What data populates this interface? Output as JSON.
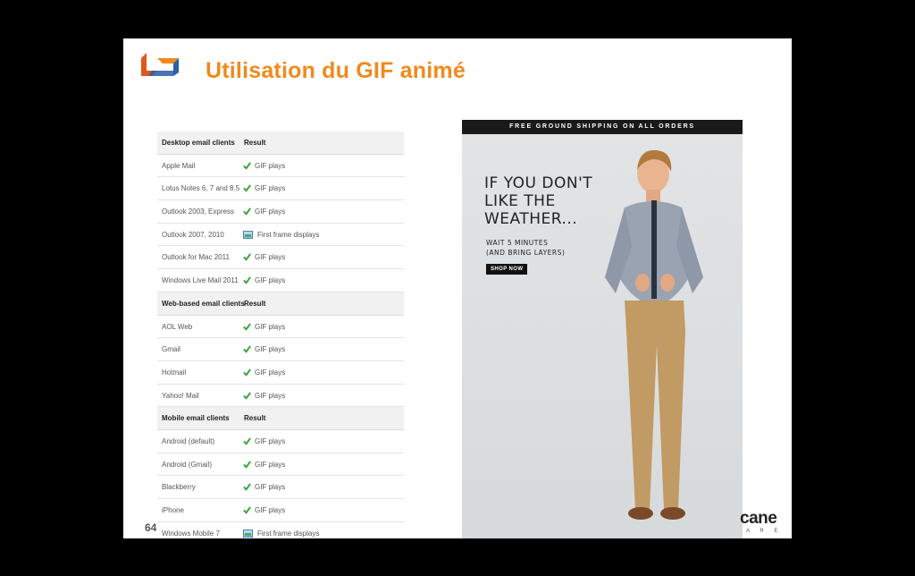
{
  "slide": {
    "title": "Utilisation du GIF animé",
    "page_number": "64",
    "colors": {
      "title": "#f08a1c",
      "check": "#3aa63a"
    }
  },
  "table": {
    "rows": [
      {
        "type": "header",
        "client": "Desktop email clients",
        "result": "Result"
      },
      {
        "client": "Apple Mail",
        "result": "GIF plays",
        "icon": "check-icon"
      },
      {
        "client": "Lotus Notes 6, 7 and 8.5",
        "result": "GIF plays",
        "icon": "check-icon"
      },
      {
        "client": "Outlook 2003, Express",
        "result": "GIF plays",
        "icon": "check-icon"
      },
      {
        "client": "Outlook 2007, 2010",
        "result": "First frame displays",
        "icon": "image-frame-icon"
      },
      {
        "client": "Outlook for Mac 2011",
        "result": "GIF plays",
        "icon": "check-icon"
      },
      {
        "client": "Windows Live Mail 2011",
        "result": "GIF plays",
        "icon": "check-icon"
      },
      {
        "type": "header",
        "client": "Web-based email clients",
        "result": "Result"
      },
      {
        "client": "AOL Web",
        "result": "GIF plays",
        "icon": "check-icon"
      },
      {
        "client": "Gmail",
        "result": "GIF plays",
        "icon": "check-icon"
      },
      {
        "client": "Hotmail",
        "result": "GIF plays",
        "icon": "check-icon"
      },
      {
        "client": "Yahoo! Mail",
        "result": "GIF plays",
        "icon": "check-icon"
      },
      {
        "type": "header",
        "client": "Mobile email clients",
        "result": "Result"
      },
      {
        "client": "Android (default)",
        "result": "GIF plays",
        "icon": "check-icon"
      },
      {
        "client": "Android (Gmail)",
        "result": "GIF plays",
        "icon": "check-icon"
      },
      {
        "client": "Blackberry",
        "result": "GIF plays",
        "icon": "check-icon"
      },
      {
        "client": "iPhone",
        "result": "GIF plays",
        "icon": "check-icon"
      },
      {
        "client": "Windows Mobile 7",
        "result": "First frame displays",
        "icon": "image-frame-icon"
      }
    ]
  },
  "email": {
    "banner": "FREE GROUND SHIPPING ON ALL ORDERS",
    "headline": "IF YOU DON'T\nLIKE THE\nWEATHER...",
    "subtext": "WAIT 5 MINUTES\n(AND BRING LAYERS)",
    "cta": "SHOP NOW"
  },
  "brand": {
    "name": "cane",
    "sub": "A R E"
  }
}
